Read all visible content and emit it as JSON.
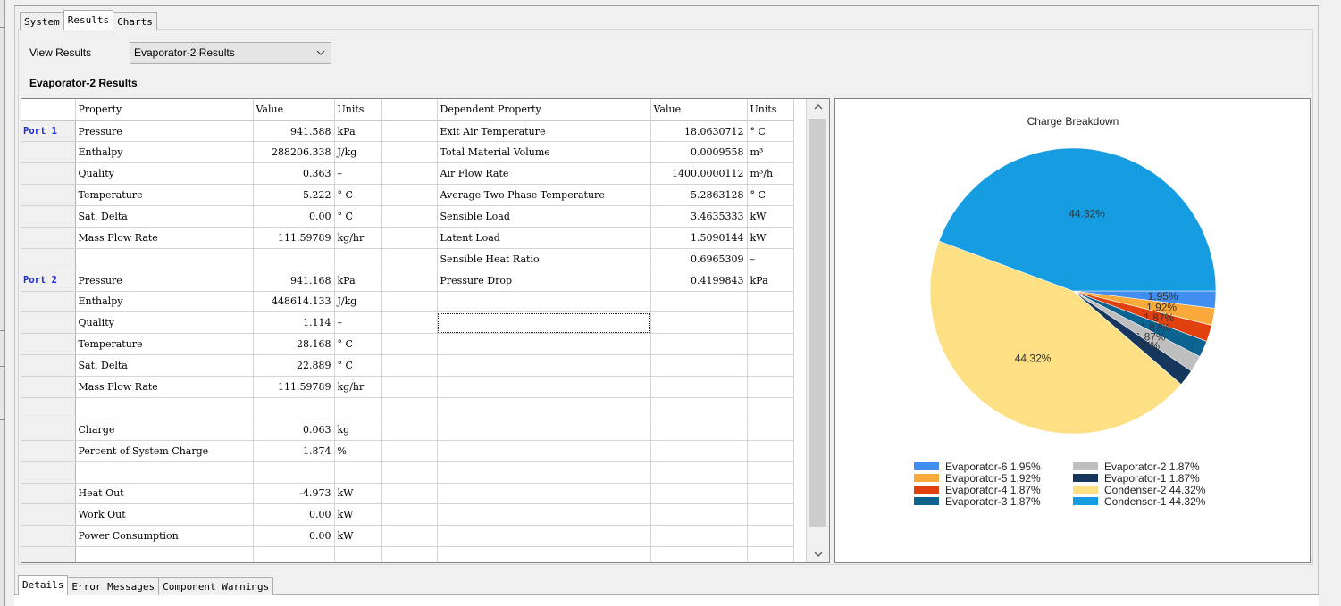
{
  "top_tabs": [
    "System",
    "Results",
    "Charts"
  ],
  "active_top_tab": 1,
  "view_results": {
    "label": "View Results",
    "selected": "Evaporator-2 Results"
  },
  "section_title": "Evaporator-2 Results",
  "grid": {
    "headers": [
      "Property",
      "Value",
      "Units",
      "",
      "Dependent Property",
      "Value",
      "Units"
    ],
    "rows": [
      [
        "Port 1",
        "Pressure",
        "941.588",
        "kPa",
        "",
        "Exit Air Temperature",
        "18.0630712",
        "° C"
      ],
      [
        "",
        "Enthalpy",
        "288206.338",
        "J/kg",
        "",
        "Total Material Volume",
        "0.0009558",
        "m³"
      ],
      [
        "",
        "Quality",
        "0.363",
        "–",
        "",
        "Air Flow Rate",
        "1400.0000112",
        "m³/h"
      ],
      [
        "",
        "Temperature",
        "5.222",
        "° C",
        "",
        "Average Two Phase Temperature",
        "5.2863128",
        "° C"
      ],
      [
        "",
        "Sat. Delta",
        "0.00",
        "° C",
        "",
        "Sensible Load",
        "3.4635333",
        "kW"
      ],
      [
        "",
        "Mass Flow Rate",
        "111.59789",
        "kg/hr",
        "",
        "Latent Load",
        "1.5090144",
        "kW"
      ],
      [
        "",
        "",
        "",
        "",
        "",
        "Sensible Heat Ratio",
        "0.6965309",
        "–"
      ],
      [
        "Port 2",
        "Pressure",
        "941.168",
        "kPa",
        "",
        "Pressure Drop",
        "0.4199843",
        "kPa"
      ],
      [
        "",
        "Enthalpy",
        "448614.133",
        "J/kg",
        "",
        "",
        "",
        ""
      ],
      [
        "",
        "Quality",
        "1.114",
        "–",
        "",
        "",
        "",
        ""
      ],
      [
        "",
        "Temperature",
        "28.168",
        "° C",
        "",
        "",
        "",
        ""
      ],
      [
        "",
        "Sat. Delta",
        "22.889",
        "° C",
        "",
        "",
        "",
        ""
      ],
      [
        "",
        "Mass Flow Rate",
        "111.59789",
        "kg/hr",
        "",
        "",
        "",
        ""
      ],
      [
        "",
        "",
        "",
        "",
        "",
        "",
        "",
        ""
      ],
      [
        "",
        "Charge",
        "0.063",
        "kg",
        "",
        "",
        "",
        ""
      ],
      [
        "",
        "Percent of System Charge",
        "1.874",
        "%",
        "",
        "",
        "",
        ""
      ],
      [
        "",
        "",
        "",
        "",
        "",
        "",
        "",
        ""
      ],
      [
        "",
        "Heat Out",
        "-4.973",
        "kW",
        "",
        "",
        "",
        ""
      ],
      [
        "",
        "Work Out",
        "0.00",
        "kW",
        "",
        "",
        "",
        ""
      ],
      [
        "",
        "Power Consumption",
        "0.00",
        "kW",
        "",
        "",
        "",
        ""
      ],
      [
        "",
        "",
        "",
        "",
        "",
        "",
        "",
        ""
      ]
    ]
  },
  "chart_data": {
    "type": "pie",
    "title": "Charge Breakdown",
    "start_angle_deg": 0,
    "direction": "clockwise",
    "slices": [
      {
        "name": "Evaporator-6",
        "value": 1.95,
        "label": "1.95%",
        "legend": "Evaporator-6 1.95%",
        "color": "#3f8ef0"
      },
      {
        "name": "Evaporator-5",
        "value": 1.92,
        "label": "1.92%",
        "legend": "Evaporator-5 1.92%",
        "color": "#f9aa3a"
      },
      {
        "name": "Evaporator-4",
        "value": 1.87,
        "label": "1.87%",
        "legend": "Evaporator-4 1.87%",
        "color": "#e1410f"
      },
      {
        "name": "Evaporator-3",
        "value": 1.87,
        "label": "1.87%",
        "legend": "Evaporator-3 1.87%",
        "color": "#0b6390"
      },
      {
        "name": "Evaporator-2",
        "value": 1.87,
        "label": "1.87%",
        "legend": "Evaporator-2 1.87%",
        "color": "#bebebe"
      },
      {
        "name": "Evaporator-1",
        "value": 1.87,
        "label": "1.87%",
        "legend": "Evaporator-1 1.87%",
        "color": "#16365e"
      },
      {
        "name": "Condenser-2",
        "value": 44.32,
        "label": "44.32%",
        "legend": "Condenser-2 44.32%",
        "color": "#fde084"
      },
      {
        "name": "Condenser-1",
        "value": 44.32,
        "label": "44.32%",
        "legend": "Condenser-1 44.32%",
        "color": "#159ce1"
      }
    ],
    "legend_placement": "bottom",
    "legend_columns": 2
  },
  "bottom_tabs": [
    "Details",
    "Error Messages",
    "Component Warnings"
  ],
  "active_bottom_tab": 0,
  "icons": {
    "dropdown": "chevron-down-icon",
    "scroll_up": "scroll-up-arrow-icon",
    "scroll_down": "scroll-down-arrow-icon"
  }
}
